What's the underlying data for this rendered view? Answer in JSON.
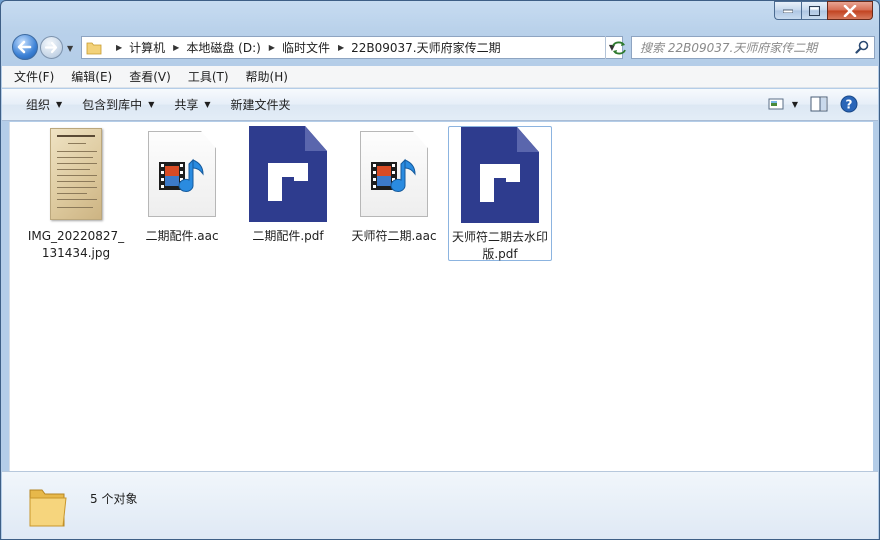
{
  "address": {
    "crumbs": [
      "计算机",
      "本地磁盘 (D:)",
      "临时文件",
      "22B09037.天师府家传二期"
    ]
  },
  "search": {
    "placeholder": "搜索 22B09037.天师府家传二期"
  },
  "menu": [
    "文件(F)",
    "编辑(E)",
    "查看(V)",
    "工具(T)",
    "帮助(H)"
  ],
  "commands": {
    "organize": "组织",
    "include_library": "包含到库中",
    "share": "共享",
    "new_folder": "新建文件夹"
  },
  "files": [
    {
      "name": "IMG_20220827_131434.jpg",
      "type": "jpg"
    },
    {
      "name": "二期配件.aac",
      "type": "aac"
    },
    {
      "name": "二期配件.pdf",
      "type": "pdf"
    },
    {
      "name": "天师符二期.aac",
      "type": "aac"
    },
    {
      "name": "天师符二期去水印版.pdf",
      "type": "pdf",
      "selected": true
    }
  ],
  "status": {
    "count_text": "5 个对象"
  },
  "colors": {
    "pdf_blue": "#2e3c8e",
    "accent": "#3d82d6",
    "close_red": "#c2421f"
  }
}
